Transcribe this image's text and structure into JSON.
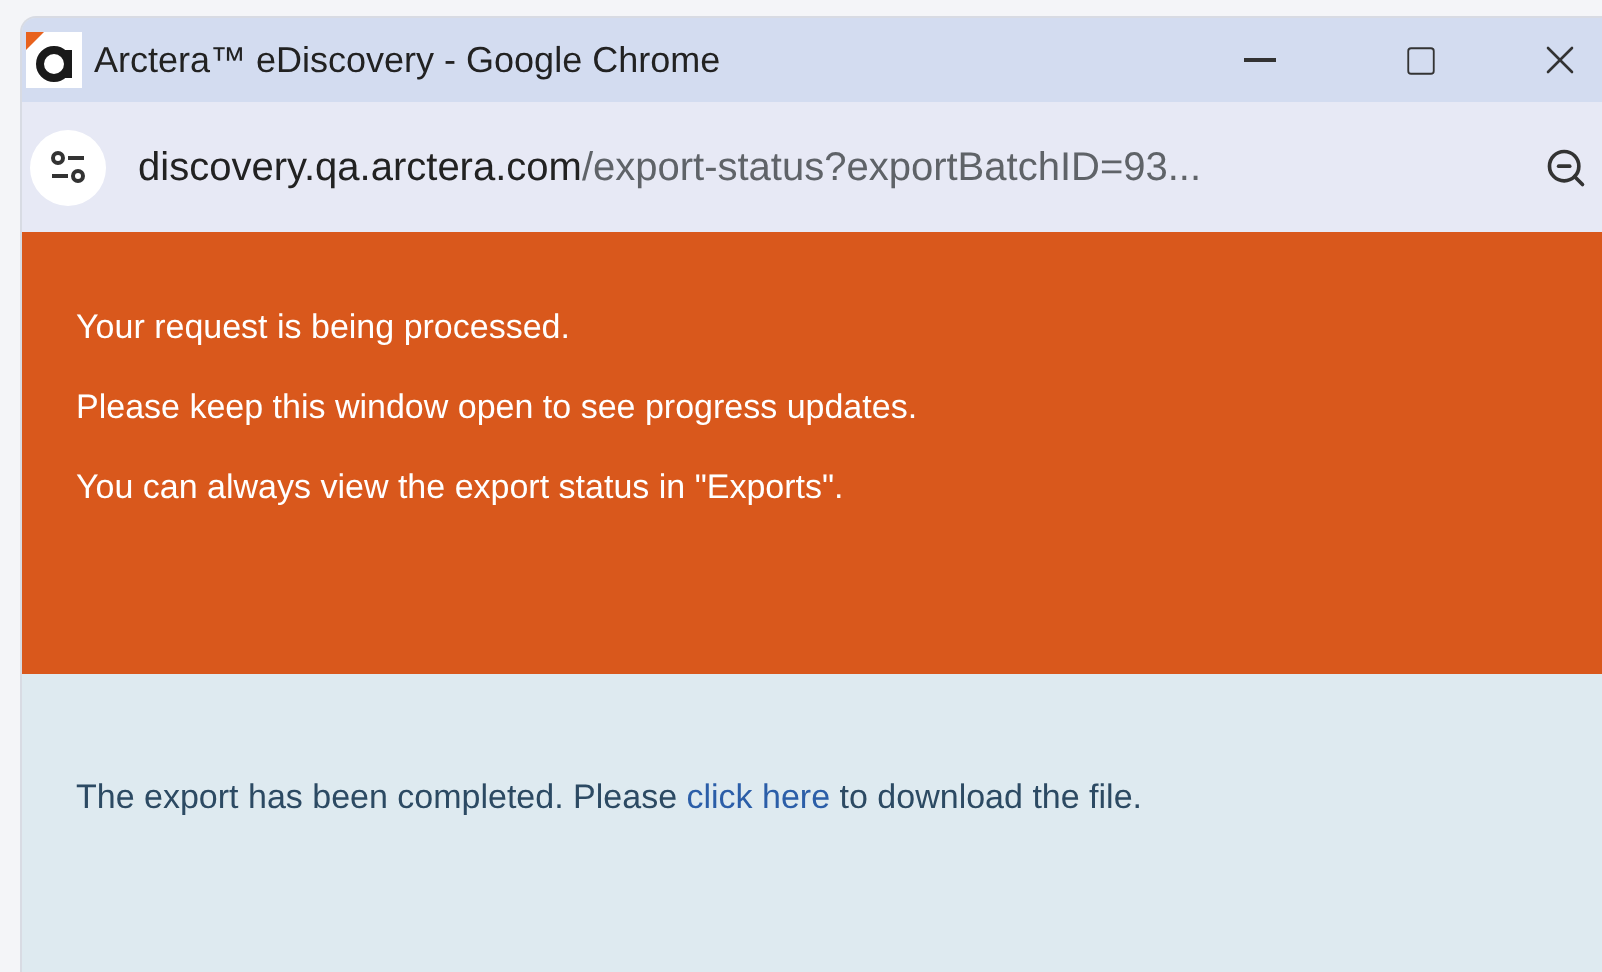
{
  "window": {
    "title": "Arctera™ eDiscovery - Google Chrome"
  },
  "address_bar": {
    "host": "discovery.qa.arctera.com",
    "path": "/export-status?exportBatchID=93..."
  },
  "banner": {
    "lines": [
      "Your request is being processed.",
      "Please keep this window open to see progress updates.",
      "You can always view the export status in \"Exports\"."
    ]
  },
  "message": {
    "before": "The export has been completed. Please ",
    "link": "click here",
    "after": " to download the file."
  }
}
